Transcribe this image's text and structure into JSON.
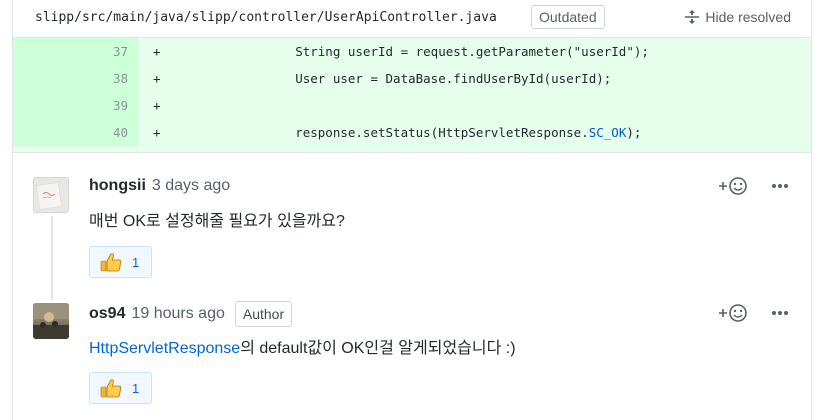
{
  "file": {
    "path": "slipp/src/main/java/slipp/controller/UserApiController.java",
    "status_badge": "Outdated",
    "hide_resolved_label": "Hide resolved"
  },
  "code_lines": [
    {
      "num": "37",
      "sign": "+",
      "code": "        String userId = request.getParameter(\"userId\");"
    },
    {
      "num": "38",
      "sign": "+",
      "code": "        User user = DataBase.findUserById(userId);"
    },
    {
      "num": "39",
      "sign": "+",
      "code": ""
    },
    {
      "num": "40",
      "sign": "+",
      "code_prefix": "        response.setStatus(HttpServletResponse.",
      "code_highlight": "SC_OK",
      "code_suffix": ");"
    }
  ],
  "comments": [
    {
      "author": "hongsii",
      "time": "3 days ago",
      "text": "매번 OK로 설정해줄 필요가 있을까요?",
      "reaction_count": "1",
      "reaction_icon": "thumbs-up"
    },
    {
      "author": "os94",
      "time": "19 hours ago",
      "badge": "Author",
      "text_link": "HttpServletResponse",
      "text_rest": "의 default값이 OK인걸 알게되었습니다 :)",
      "reaction_count": "1",
      "reaction_icon": "thumbs-up"
    }
  ],
  "colors": {
    "added_bg": "#e6ffed",
    "added_gutter": "#cdffd8",
    "link": "#0366d6",
    "reaction_bg": "#f1f8ff",
    "reaction_border": "#c8e1ff"
  },
  "icons": [
    "unfold-icon",
    "add-reaction-icon",
    "more-options-icon",
    "thumbs-up-icon"
  ]
}
